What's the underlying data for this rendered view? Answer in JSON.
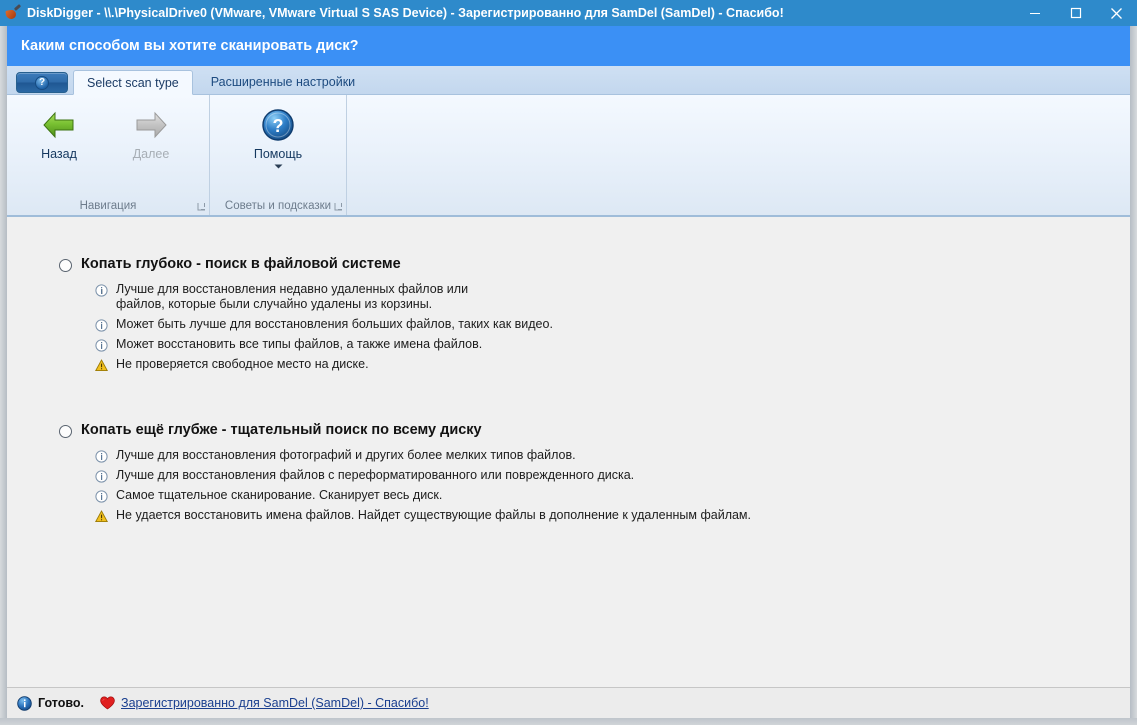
{
  "window": {
    "title": "DiskDigger - \\\\.\\PhysicalDrive0 (VMware, VMware Virtual S SAS Device) - Зарегистрированно для SamDel (SamDel) - Спасибо!",
    "app_icon": "shovel-icon",
    "buttons": {
      "minimize": "minimize-icon",
      "maximize": "maximize-icon",
      "close": "close-icon"
    },
    "colors": {
      "titlebar": "#2e8acb",
      "header_banner": "#3b90f5",
      "content_bg": "#f0f0f0",
      "ribbon_top": "#f4f9ff",
      "ribbon_bottom": "#dde8f4",
      "link": "#1a3f8f",
      "heart": "#e02020",
      "warning": "#f2c01e"
    }
  },
  "header": {
    "title": "Каким способом вы хотите сканировать диск?"
  },
  "tabstrip": {
    "help_button_icon": "question-mark-icon",
    "tabs": [
      {
        "label": "Select scan type",
        "active": true
      },
      {
        "label": "Расширенные настройки",
        "active": false
      }
    ]
  },
  "ribbon": {
    "groups": [
      {
        "label": "Навигация",
        "launcher_icon": "dialog-launcher-icon",
        "buttons": [
          {
            "label": "Назад",
            "icon": "arrow-left-green-icon",
            "enabled": true
          },
          {
            "label": "Далее",
            "icon": "arrow-right-grey-icon",
            "enabled": false
          }
        ]
      },
      {
        "label": "Советы и подсказки",
        "launcher_icon": "dialog-launcher-icon",
        "buttons": [
          {
            "label": "Помощь",
            "icon": "help-circle-blue-icon",
            "enabled": true,
            "has_dropdown": true
          }
        ]
      }
    ]
  },
  "main": {
    "options": [
      {
        "title": "Копать глубоко - поиск в файловой системе",
        "selected": false,
        "bullets": [
          {
            "icon": "info-icon",
            "text": "Лучше для восстановления недавно удаленных файлов или\nфайлов, которые были случайно удалены из корзины."
          },
          {
            "icon": "info-icon",
            "text": "Может быть лучше для восстановления больших файлов, таких как видео."
          },
          {
            "icon": "info-icon",
            "text": "Может восстановить все типы файлов, а также имена файлов."
          },
          {
            "icon": "warning-icon",
            "text": "Не проверяется свободное место на диске."
          }
        ]
      },
      {
        "title": "Копать ещё глубже - тщательный поиск по всему диску",
        "selected": false,
        "bullets": [
          {
            "icon": "info-icon",
            "text": "Лучше для восстановления фотографий и других более мелких типов файлов."
          },
          {
            "icon": "info-icon",
            "text": "Лучше для восстановления файлов с переформатированного или поврежденного диска."
          },
          {
            "icon": "info-icon",
            "text": "Самое тщательное сканирование. Сканирует весь диск."
          },
          {
            "icon": "warning-icon",
            "text": "Не удается восстановить имена файлов. Найдет существующие файлы в дополнение к удаленным файлам."
          }
        ]
      }
    ]
  },
  "statusbar": {
    "info_icon": "info-circle-icon",
    "status_text": "Готово.",
    "heart_icon": "heart-icon",
    "link_text": "Зарегистрированно для SamDel (SamDel) - Спасибо!"
  }
}
